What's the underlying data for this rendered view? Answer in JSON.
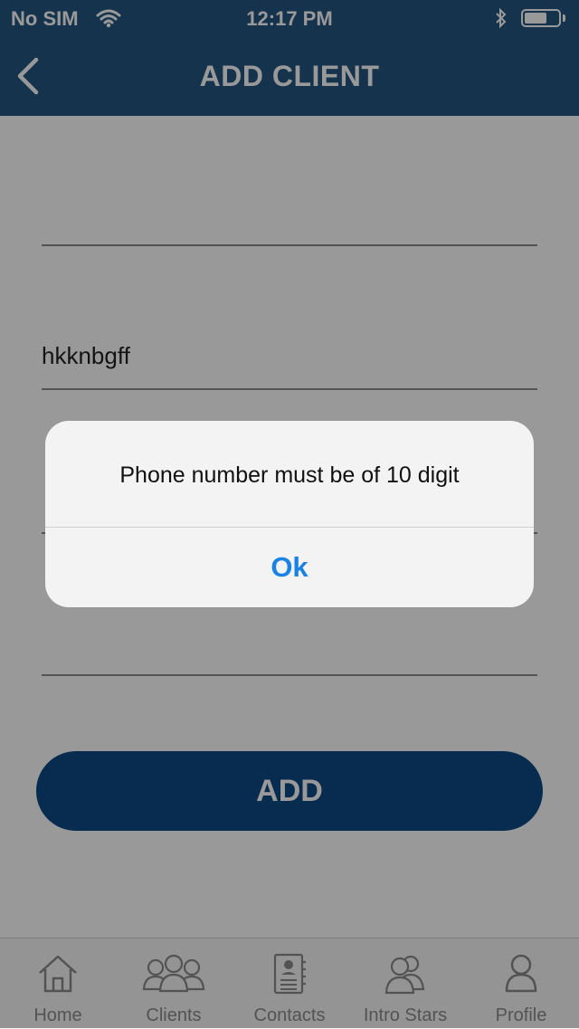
{
  "status_bar": {
    "carrier": "No SIM",
    "time": "12:17 PM"
  },
  "nav": {
    "title": "ADD CLIENT",
    "back_icon": "chevron-left-icon"
  },
  "form": {
    "field2_value": "hkknbgff",
    "add_label": "ADD"
  },
  "tabs": [
    {
      "label": "Home",
      "icon": "home-icon"
    },
    {
      "label": "Clients",
      "icon": "clients-icon"
    },
    {
      "label": "Contacts",
      "icon": "contacts-icon"
    },
    {
      "label": "Intro Stars",
      "icon": "intro-stars-icon"
    },
    {
      "label": "Profile",
      "icon": "profile-icon"
    }
  ],
  "alert": {
    "message": "Phone number must be of 10 digit",
    "ok_label": "Ok"
  },
  "colors": {
    "nav_bg": "#255580",
    "button_bg": "#0c4a84",
    "alert_button": "#1a82e2"
  }
}
